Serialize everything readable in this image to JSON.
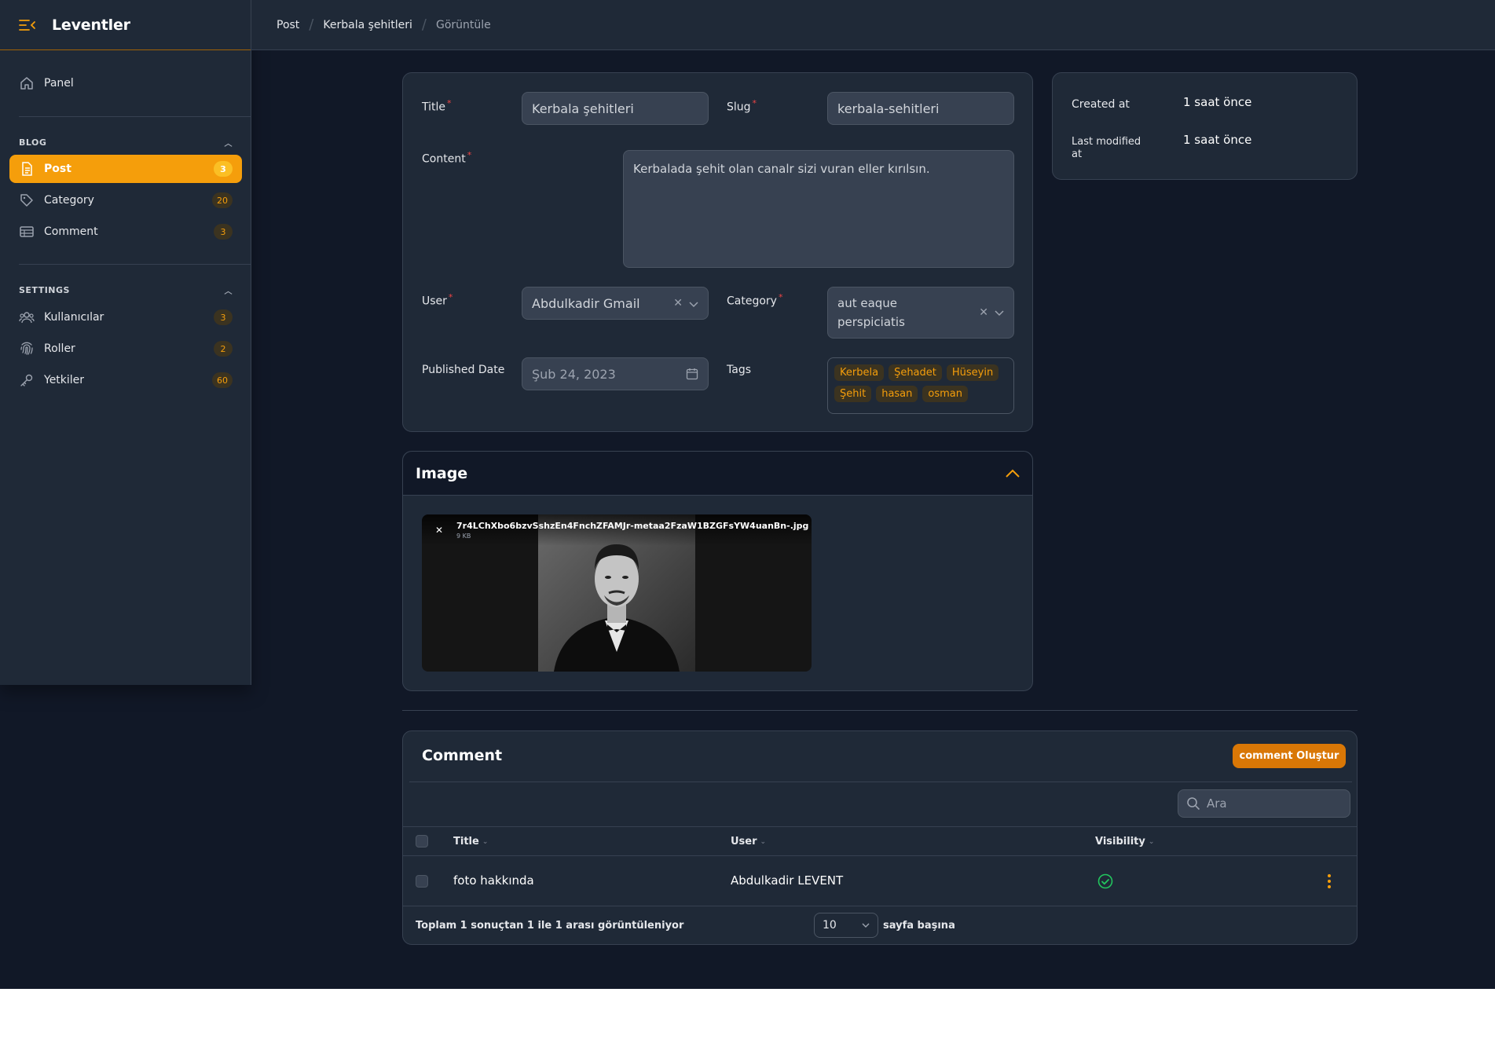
{
  "app": {
    "brand": "Leventler"
  },
  "sidebar": {
    "panel": "Panel",
    "blog_group": "BLOG",
    "blog_items": [
      {
        "label": "Post",
        "badge": "3",
        "icon": "document-icon"
      },
      {
        "label": "Category",
        "badge": "20",
        "icon": "tag-icon"
      },
      {
        "label": "Comment",
        "badge": "3",
        "icon": "table-icon"
      }
    ],
    "settings_group": "SETTINGS",
    "settings_items": [
      {
        "label": "Kullanıcılar",
        "badge": "3",
        "icon": "users-icon"
      },
      {
        "label": "Roller",
        "badge": "2",
        "icon": "fingerprint-icon"
      },
      {
        "label": "Yetkiler",
        "badge": "60",
        "icon": "key-icon"
      }
    ]
  },
  "breadcrumb": {
    "items": [
      "Post",
      "Kerbala şehitleri",
      "Görüntüle"
    ]
  },
  "form": {
    "title_label": "Title",
    "title_value": "Kerbala şehitleri",
    "slug_label": "Slug",
    "slug_value": "kerbala-sehitleri",
    "content_label": "Content",
    "content_value": "Kerbalada şehit olan canalr sizi vuran eller kırılsın.",
    "user_label": "User",
    "user_value": "Abdulkadir Gmail",
    "category_label": "Category",
    "category_value_line1": "aut eaque",
    "category_value_line2": "perspiciatis",
    "published_label": "Published Date",
    "published_value": "Şub 24, 2023",
    "tags_label": "Tags",
    "tags": [
      "Kerbela",
      "Şehadet",
      "Hüseyin",
      "Şehit",
      "hasan",
      "osman"
    ]
  },
  "meta": {
    "created_label": "Created at",
    "created_value": "1 saat önce",
    "modified_label_1": "Last modified",
    "modified_label_2": "at",
    "modified_value": "1 saat önce"
  },
  "image_section": {
    "title": "Image",
    "file_name": "7r4LChXbo6bzvSshzEn4FnchZFAMJr-metaa2FzaW1BZGFsYW4uanBn-.jpg",
    "file_size": "9 KB"
  },
  "comments": {
    "title": "Comment",
    "create_button": "comment Oluştur",
    "search_placeholder": "Ara",
    "columns": [
      "Title",
      "User",
      "Visibility"
    ],
    "rows": [
      {
        "title": "foto hakkında",
        "user": "Abdulkadir LEVENT",
        "visible": true
      }
    ],
    "summary": "Toplam 1 sonuçtan 1 ile 1 arası görüntüleniyor",
    "per_page_value": "10",
    "per_page_label": "sayfa başına"
  },
  "colors": {
    "accent": "#f59e0b",
    "background": "#111827",
    "surface": "#1f2937",
    "success": "#22c55e",
    "danger": "#ef4444"
  }
}
